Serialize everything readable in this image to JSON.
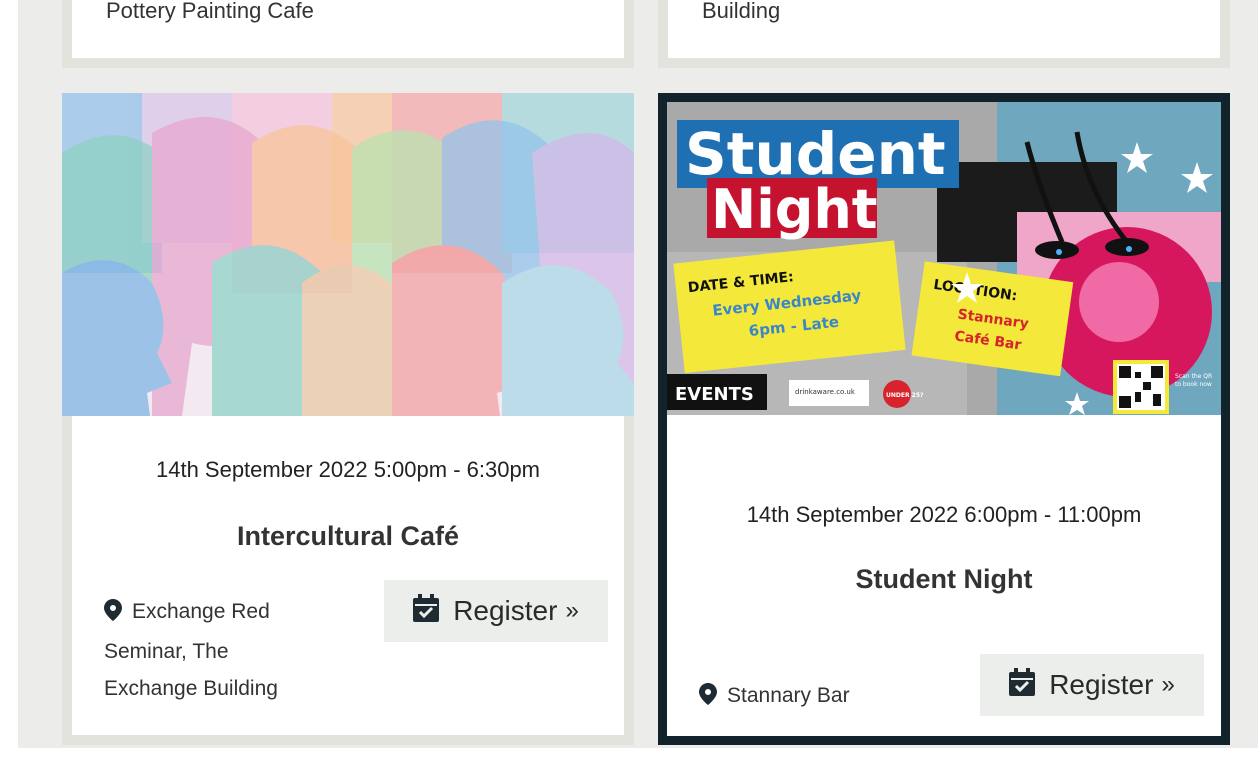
{
  "top_cards": [
    {
      "title_fragment": "Pottery Painting Cafe"
    },
    {
      "title_fragment": "Building"
    }
  ],
  "events": [
    {
      "date": "14th September 2022 5:00pm - 6:30pm",
      "name": "Intercultural Café",
      "location_lines": [
        "Exchange Red",
        "Seminar, The",
        "Exchange Building"
      ],
      "register_label": "Register",
      "register_suffix": "»"
    },
    {
      "date": "14th September 2022 6:00pm - 11:00pm",
      "name": "Student Night",
      "location": "Stannary Bar",
      "register_label": "Register",
      "register_suffix": "»",
      "poster": {
        "headline_1": "Student",
        "headline_2": "Night",
        "date_time_label": "DATE & TIME:",
        "date_time_line_1": "Every Wednesday",
        "date_time_line_2": "6pm - Late",
        "location_label": "LOCATION:",
        "location_line_1": "Stannary",
        "location_line_2": "Café Bar",
        "events_logo": "EVENTS",
        "drinkaware": "drinkaware.co.uk",
        "badge": "UNDER 25?",
        "qr_note_1": "Scan the QR",
        "qr_note_2": "to book now"
      }
    }
  ],
  "colors": {
    "page_bg": "#ececea",
    "card_border": "#e3e3dd",
    "active_border": "#12232c",
    "button_bg": "#eceeec"
  },
  "icons": [
    "map-marker-icon",
    "calendar-check-icon"
  ]
}
